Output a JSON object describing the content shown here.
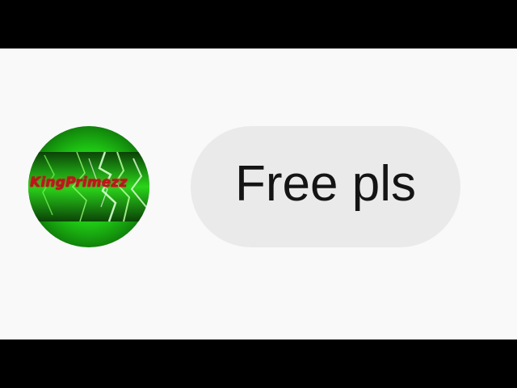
{
  "message": {
    "sender": {
      "avatar_text": "KingPrimezz",
      "avatar_text_color": "#c4141a",
      "avatar_colors": [
        "#3cff2a",
        "#1ec313",
        "#0c6a08"
      ]
    },
    "text": "Free pls",
    "bubble_color": "#eaeaea"
  }
}
